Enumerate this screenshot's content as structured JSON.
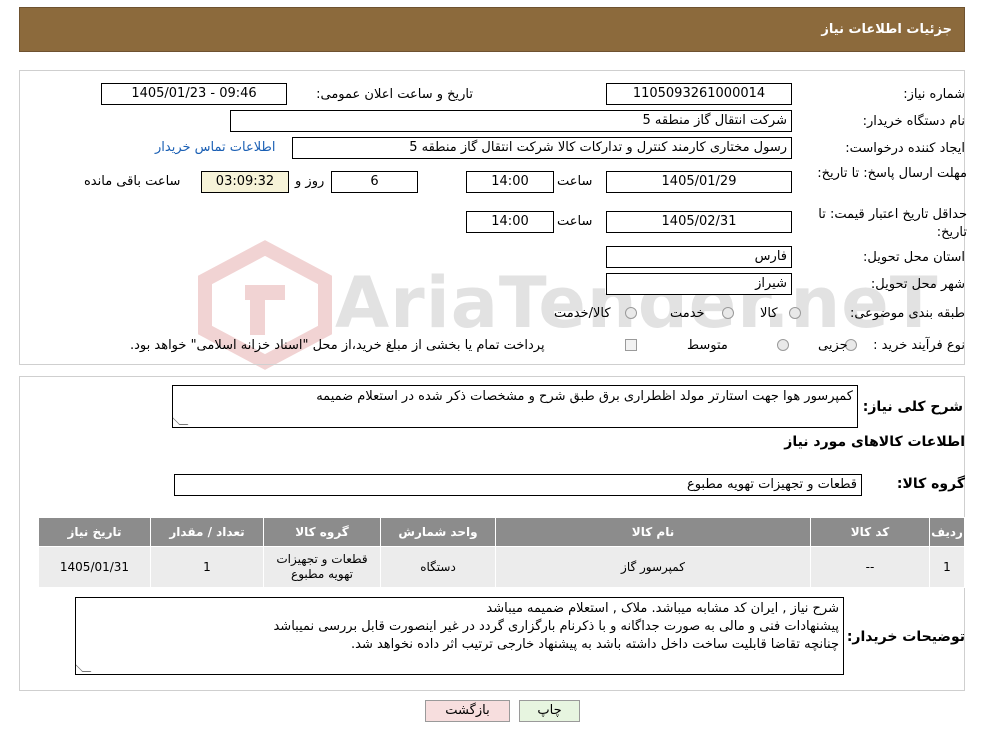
{
  "header": {
    "title": "جزئیات اطلاعات نیاز"
  },
  "watermark": {
    "text": "AriaTender.neT"
  },
  "form": {
    "need_number": {
      "label": "شماره نیاز:",
      "value": "1105093261000014"
    },
    "announce_datetime": {
      "label": "تاریخ و ساعت اعلان عمومی:",
      "value": "1405/01/23 - 09:46"
    },
    "buyer_org": {
      "label": "نام دستگاه خریدار:",
      "value": "شرکت انتقال گاز منطقه 5"
    },
    "requester": {
      "label": "ایجاد کننده درخواست:",
      "value": "رسول  مختاری کارمند کنترل و تداركات كالا شرکت انتقال گاز منطقه 5",
      "contact_link": "اطلاعات تماس خریدار"
    },
    "reply_deadline": {
      "label": "مهلت ارسال پاسخ: تا تاریخ:",
      "date": "1405/01/29",
      "time_label": "ساعت",
      "time": "14:00",
      "days": "6",
      "days_label": "روز و",
      "remaining": "03:09:32",
      "remaining_label": "ساعت باقی مانده"
    },
    "price_validity": {
      "label": "حداقل تاریخ اعتبار قیمت: تا تاریخ:",
      "date": "1405/02/31",
      "time_label": "ساعت",
      "time": "14:00"
    },
    "province": {
      "label": "استان محل تحویل:",
      "value": "فارس"
    },
    "city": {
      "label": "شهر محل تحویل:",
      "value": "شیراز"
    },
    "category": {
      "label": "طبقه بندی موضوعی:",
      "options": [
        "کالا",
        "خدمت",
        "کالا/خدمت"
      ]
    },
    "purchase_type": {
      "label": "نوع فرآیند خرید :",
      "options": [
        "جزیی",
        "متوسط"
      ],
      "note": "پرداخت تمام یا بخشی از مبلغ خرید،از محل \"اسناد خزانه اسلامی\" خواهد بود."
    }
  },
  "description": {
    "label": "شرح کلی نیاز:",
    "value": "کمپرسور هوا جهت استارتر مولد اظطراری برق طبق شرح و مشخصات ذکر شده در استعلام ضمیمه"
  },
  "goods_section": {
    "title": "اطلاعات کالاهای مورد نیاز"
  },
  "goods_group": {
    "label": "گروه کالا:",
    "value": "قطعات و تجهیزات تهویه مطبوع"
  },
  "table": {
    "headers": [
      "ردیف",
      "کد کالا",
      "نام کالا",
      "واحد شمارش",
      "گروه کالا",
      "تعداد / مقدار",
      "تاریخ نیاز"
    ],
    "rows": [
      [
        "1",
        "--",
        "کمپرسور گاز",
        "دستگاه",
        "قطعات و تجهیزات تهویه مطبوع",
        "1",
        "1405/01/31"
      ]
    ]
  },
  "buyer_notes": {
    "label": "توضیحات خریدار:",
    "lines": [
      "شرح نیاز , ایران کد مشابه میباشد. ملاک , استعلام ضمیمه میباشد",
      "پیشنهادات فنی و مالی به صورت جداگانه و با ذکرنام بارگزاری گردد در غیر اینصورت قابل بررسی نمیباشد",
      "چنانچه تقاضا قابلیت ساخت داخل داشته باشد به پیشنهاد خارجی ترتیب اثر داده نخواهد شد."
    ]
  },
  "buttons": {
    "print": "چاپ",
    "back": "بازگشت"
  },
  "colors": {
    "header_bg": "#8c6a3c",
    "table_header_bg": "#8c8c8c",
    "link": "#1a5fb4",
    "back_btn_bg": "#f7dede",
    "print_btn_bg": "#e7f5e0"
  }
}
